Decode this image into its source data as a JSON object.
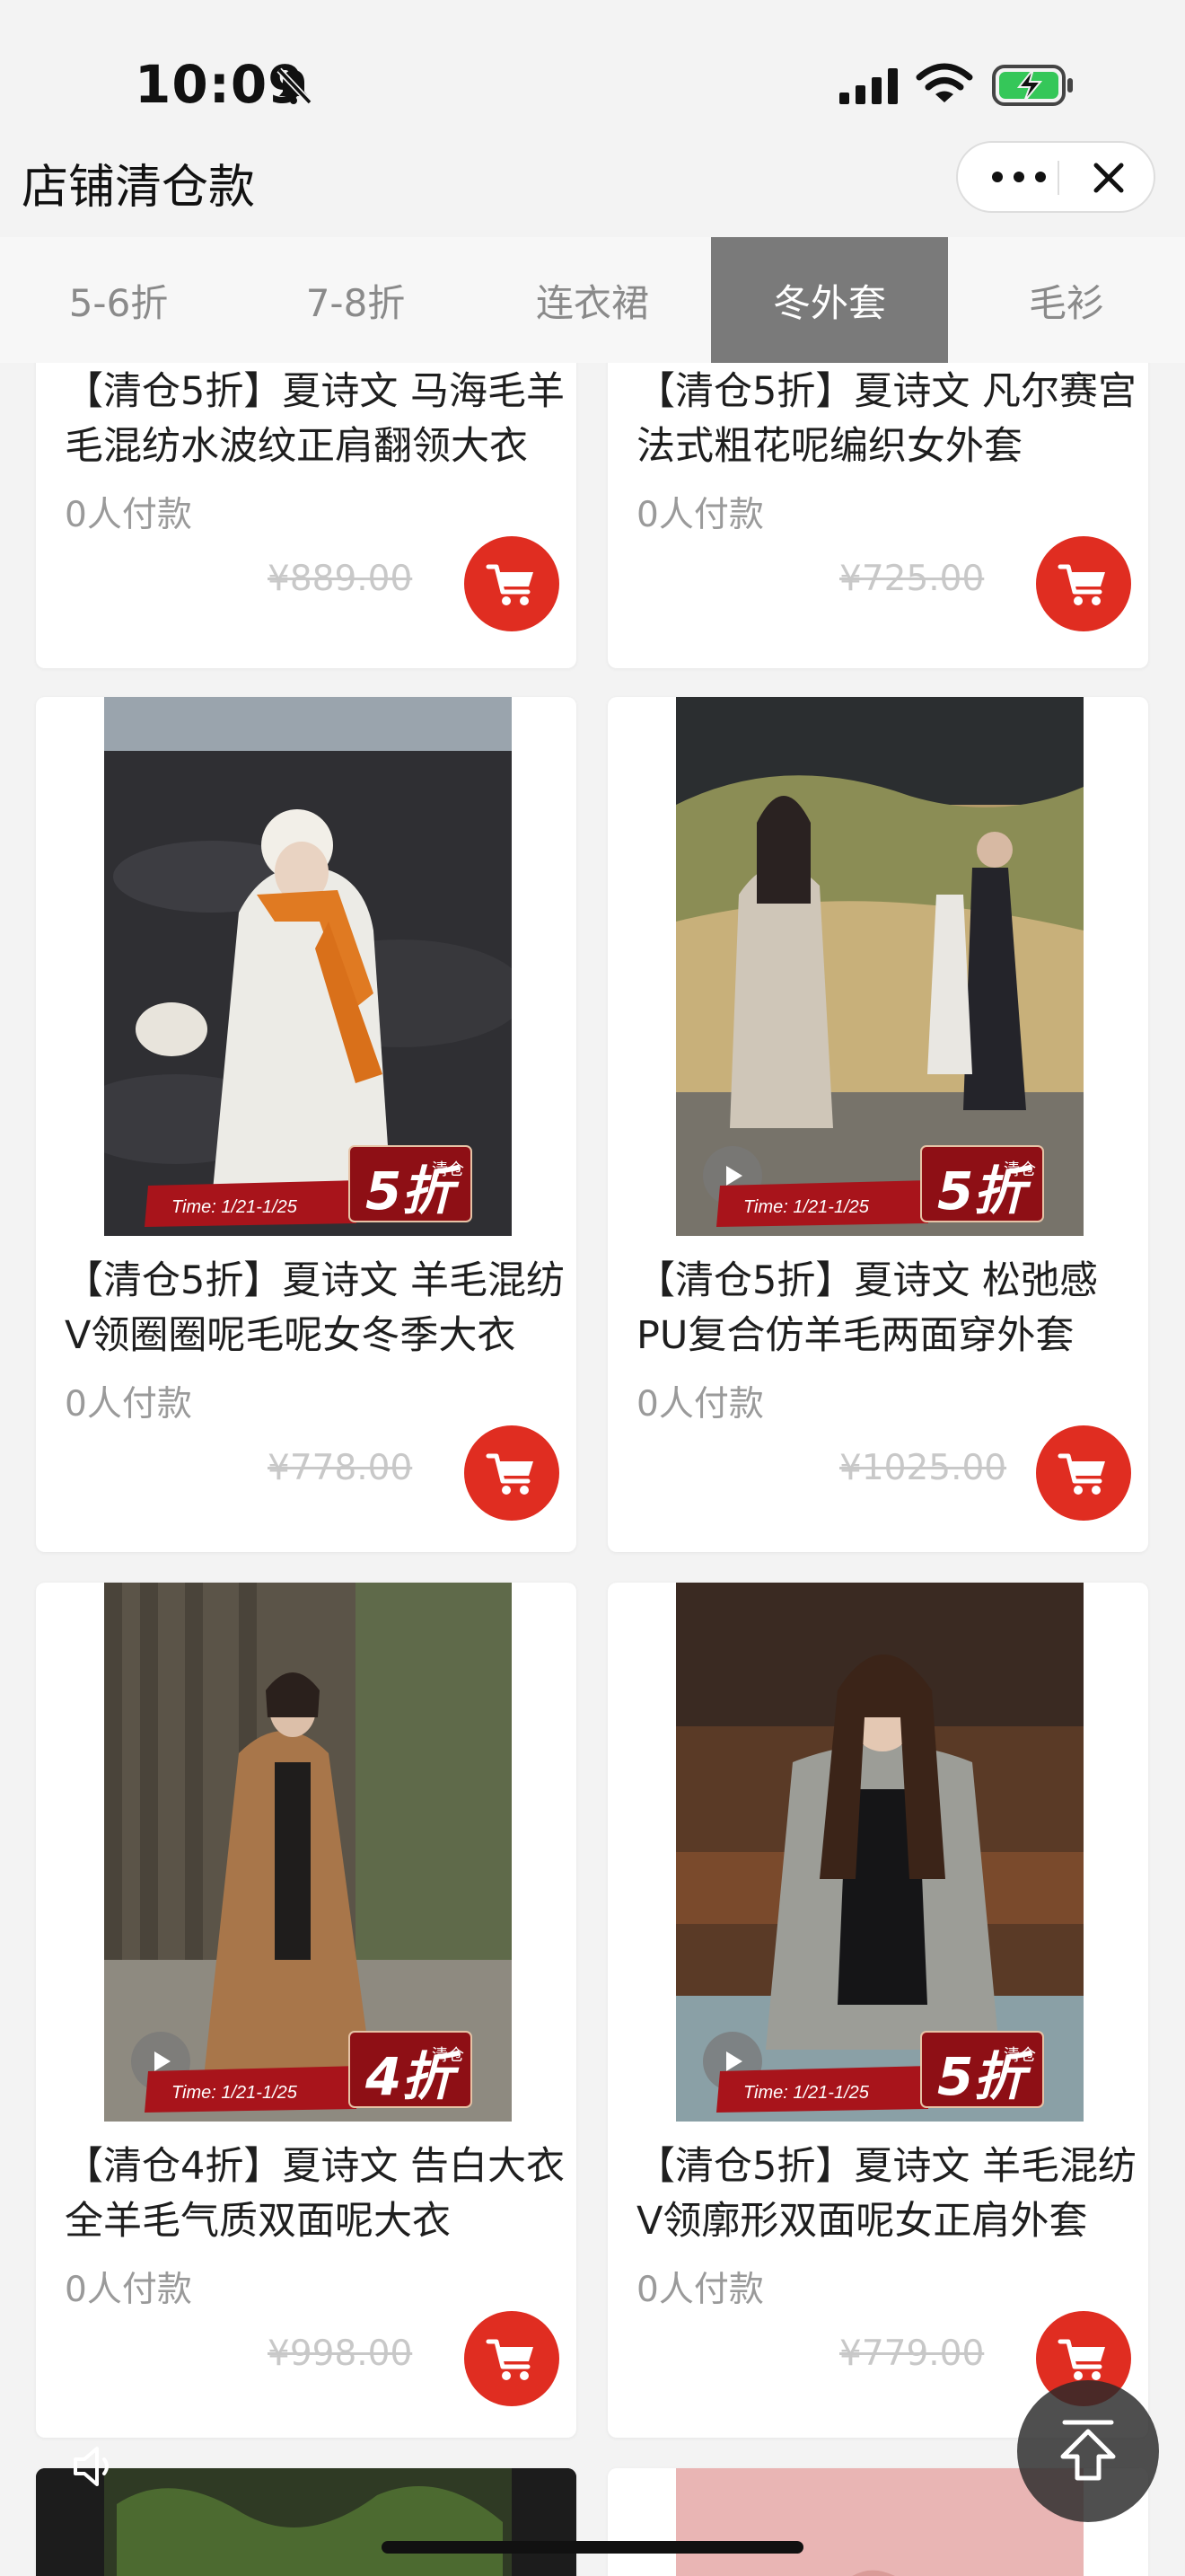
{
  "status": {
    "time": "10:09"
  },
  "header": {
    "title": "店铺清仓款"
  },
  "tabs": [
    {
      "label": "5-6折"
    },
    {
      "label": "7-8折"
    },
    {
      "label": "连衣裙"
    },
    {
      "label": "冬外套",
      "active": true
    },
    {
      "label": "毛衫"
    }
  ],
  "products": [
    {
      "title": "【清仓5折】夏诗文 马海毛羊毛混纺水波纹正肩翻领大衣",
      "paid": "0人付款",
      "price": "¥889.00"
    },
    {
      "title": "【清仓5折】夏诗文 凡尔赛宫 法式粗花呢编织女外套",
      "paid": "0人付款",
      "price": "¥725.00"
    },
    {
      "title": "【清仓5折】夏诗文 羊毛混纺V领圈圈呢毛呢女冬季大衣",
      "paid": "0人付款",
      "price": "¥778.00",
      "badge": {
        "time": "Time: 1/21-1/25",
        "discount": "5折",
        "tag": "清仓"
      }
    },
    {
      "title": "【清仓5折】夏诗文 松弛感PU复合仿羊毛两面穿外套",
      "paid": "0人付款",
      "price": "¥1025.00",
      "badge": {
        "time": "Time: 1/21-1/25",
        "discount": "5折",
        "tag": "清仓"
      }
    },
    {
      "title": "【清仓4折】夏诗文 告白大衣 全羊毛气质双面呢大衣",
      "paid": "0人付款",
      "price": "¥998.00",
      "badge": {
        "time": "Time: 1/21-1/25",
        "discount": "4折",
        "tag": "清仓"
      }
    },
    {
      "title": "【清仓5折】夏诗文 羊毛混纺V领廓形双面呢女正肩外套",
      "paid": "0人付款",
      "price": "¥779.00",
      "badge": {
        "time": "Time: 1/21-1/25",
        "discount": "5折",
        "tag": "清仓"
      }
    }
  ],
  "colors": {
    "accent": "#e02d21",
    "tab_active_bg": "#7a7a7a",
    "badge_red": "#a8141b"
  }
}
